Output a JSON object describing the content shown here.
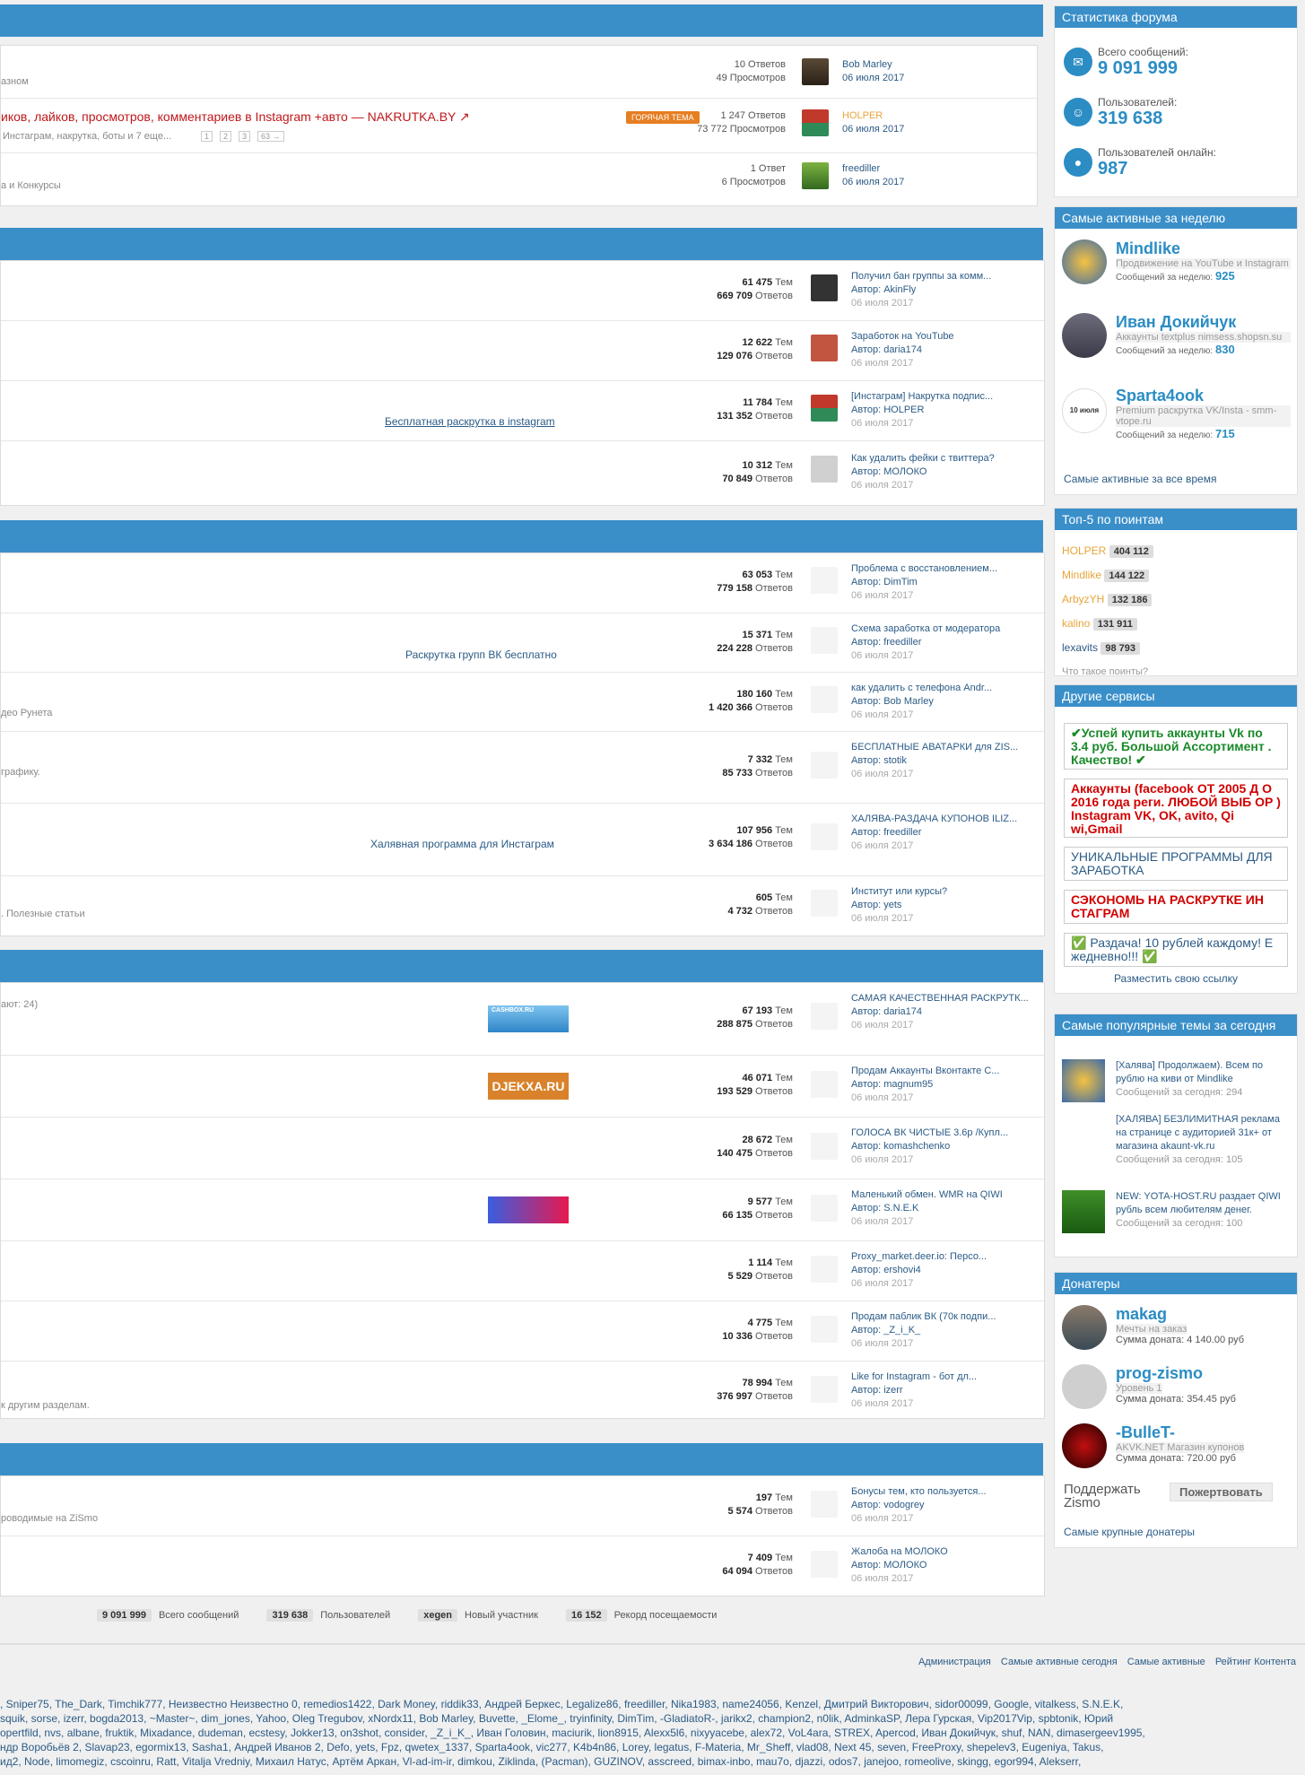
{
  "sec1": {
    "threads": [
      {
        "title": "",
        "sub": "азном",
        "replies": "10 Ответов",
        "views": "49 Просмотров",
        "last_user": "Bob Marley",
        "last_date": "06 июля 2017"
      },
      {
        "title": "иков, лайков, просмотров, комментариев в Instagram +авто — NAKRUTKA.BY ↗",
        "tag": "ГОРЯЧАЯ ТЕМА",
        "sub": "Инстаграм, накрутка, боты и 7 еще...",
        "pages": [
          "1",
          "2",
          "3",
          "63 →"
        ],
        "replies": "1 247 Ответов",
        "views": "73 772 Просмотров",
        "last_user": "HOLPER",
        "last_date": "06 июля 2017"
      },
      {
        "title": "",
        "sub": "а и Конкурсы",
        "replies": "1 Ответ",
        "views": "6 Просмотров",
        "last_user": "freediller",
        "last_date": "06 июля 2017"
      }
    ]
  },
  "sec2": {
    "forums": [
      {
        "link": "",
        "topics": "61 475",
        "posts": "669 709",
        "last_title": "Получил бан группы за комм...",
        "last_author": "Автор: AkinFly",
        "last_date": "06 июля 2017"
      },
      {
        "link": "",
        "topics": "12 622",
        "posts": "129 076",
        "last_title": "Заработок на YouTube",
        "last_author": "Автор: daria174",
        "last_date": "06 июля 2017"
      },
      {
        "link": "Бесплатная раскрутка в instagram",
        "topics": "11 784",
        "posts": "131 352",
        "last_title": "[Инстаграм] Накрутка подпис...",
        "last_author": "Автор: HOLPER",
        "last_date": "06 июля 2017"
      },
      {
        "link": "",
        "topics": "10 312",
        "posts": "70 849",
        "last_title": "Как удалить фейки с твиттера?",
        "last_author": "Автор: МОЛОКО",
        "last_date": "06 июля 2017"
      }
    ]
  },
  "sec3": {
    "forums": [
      {
        "desc": "",
        "link": "",
        "topics": "63 053",
        "posts": "779 158",
        "last_title": "Проблема с восстановлением...",
        "last_author": "Автор: DimTim",
        "last_date": "06 июля 2017"
      },
      {
        "desc": "",
        "link": "Раскрутка групп ВК бесплатно",
        "topics": "15 371",
        "posts": "224 228",
        "last_title": "Схема заработка от модератора",
        "last_author": "Автор: freediller",
        "last_date": "06 июля 2017"
      },
      {
        "desc": "део Рунета",
        "link": "",
        "topics": "180 160",
        "posts": "1 420 366",
        "last_title": "как удалить с телефона Andr...",
        "last_author": "Автор: Bob Marley",
        "last_date": "06 июля 2017"
      },
      {
        "desc": "графику.",
        "link": "",
        "topics": "7 332",
        "posts": "85 733",
        "last_title": "БЕСПЛАТНЫЕ АВАТАРКИ для ZIS...",
        "last_author": "Автор: stotik",
        "last_date": "06 июля 2017"
      },
      {
        "desc": "",
        "link": "Халявная программа для Инстаграм",
        "topics": "107 956",
        "posts": "3 634 186",
        "last_title": "ХАЛЯВА-РАЗДАЧА КУПОНОВ ILIZ...",
        "last_author": "Автор: freediller",
        "last_date": "06 июля 2017"
      },
      {
        "desc": ". Полезные статьи",
        "link": "",
        "topics": "605",
        "posts": "4 732",
        "last_title": "Институт или курсы?",
        "last_author": "Автор: yets",
        "last_date": "06 июля 2017"
      }
    ]
  },
  "sec4": {
    "forums": [
      {
        "desc": "ают: 24)",
        "banner": "CASHBOX.RU",
        "topics": "67 193",
        "posts": "288 875",
        "last_title": "САМАЯ КАЧЕСТВЕННАЯ РАСКРУТК...",
        "last_author": "Автор: daria174",
        "last_date": "06 июля 2017"
      },
      {
        "desc": "",
        "banner": "DJEKXA.RU",
        "topics": "46 071",
        "posts": "193 529",
        "last_title": "Продам Аккаунты Вконтакте С...",
        "last_author": "Автор: magnum95",
        "last_date": "06 июля 2017"
      },
      {
        "desc": "",
        "banner": "",
        "topics": "28 672",
        "posts": "140 475",
        "last_title": "ГОЛОСА ВК ЧИСТЫЕ 3.6р /Купл...",
        "last_author": "Автор: komashchenko",
        "last_date": "06 июля 2017"
      },
      {
        "desc": "",
        "banner": "gradient",
        "topics": "9 577",
        "posts": "66 135",
        "last_title": "Маленький обмен. WMR на QIWI",
        "last_author": "Автор: S.N.E.K",
        "last_date": "06 июля 2017"
      },
      {
        "desc": "",
        "banner": "",
        "topics": "1 114",
        "posts": "5 529",
        "last_title": "Proxy_market.deer.io: Персо...",
        "last_author": "Автор: ershovi4",
        "last_date": "06 июля 2017"
      },
      {
        "desc": "",
        "banner": "",
        "topics": "4 775",
        "posts": "10 336",
        "last_title": "Продам паблик ВК (70к подпи...",
        "last_author": "Автор: _Z_i_K_",
        "last_date": "06 июля 2017"
      },
      {
        "desc": "к другим разделам.",
        "banner": "",
        "topics": "78 994",
        "posts": "376 997",
        "last_title": "Like for Instagram - бот дл...",
        "last_author": "Автор: izerr",
        "last_date": "06 июля 2017"
      }
    ]
  },
  "sec5": {
    "forums": [
      {
        "desc": "роводимые на ZiSmo",
        "topics": "197",
        "posts": "5 574",
        "last_title": "Бонусы тем, кто пользуется...",
        "last_author": "Автор: vodogrey",
        "last_date": "06 июля 2017"
      },
      {
        "desc": "",
        "topics": "7 409",
        "posts": "64 094",
        "last_title": "Жалоба на МОЛОКО",
        "last_author": "Автор: МОЛОКО",
        "last_date": "06 июля 2017"
      }
    ]
  },
  "labels": {
    "topics": "Тем",
    "posts": "Ответов"
  },
  "footer_stats": [
    {
      "value": "9 091 999",
      "label": "Всего сообщений"
    },
    {
      "value": "319 638",
      "label": "Пользователей"
    },
    {
      "value": "xegen",
      "label": "Новый участник"
    },
    {
      "value": "16 152",
      "label": "Рекорд посещаемости"
    }
  ],
  "footer_links": [
    "Администрация",
    "Самые активные сегодня",
    "Самые активные",
    "Рейтинг Контента"
  ],
  "online_users": [
    ", Sniper75, The_Dark, Timchik777, Неизвестно Неизвестно 0, remedios1422, Dark Money, riddik33, Андрей Беркес, Legalize86, freediller, Nika1983, name24056, Kenzel, Дмитрий Викторович, sidor00099, Google, vitalkess, S.N.E.K,",
    "squik, sorse, izerr, bogda2013, ~Master~, dim_jones, Yahoo, Oleg Tregubov, xNordx11, Bob Marley, Buvette, _Elome_, tryinfinity, DimTim, -GladiatoR-, jarikx2, champion2, n0lik, AdminkaSP, Лера Гурская, Vip2017Vip, spbtonik, Юрий",
    "opertfild, nvs, albane, fruktik, Mixadance, dudeman, ecstesy, Jokker13, on3shot, consider, _Z_i_K_, Иван Головин, maciurik, lion8915, Alexx5l6, nixyyacebe, alex72, VoL4ara, STREX, Apercod, Иван Докийчук, shuf, NAN, dimasergeev1995,",
    "ндр Воробьёв 2, Slavap23, egormix13, Sasha1, Андрей Иванов 2, Defo, yets, Fpz, qwetex_1337, Sparta4ook, vic277, K4b4n86, Lorey, legatus, F-Materia, Mr_Sheff, vlad08, Next 45, seven, FreeProxy, shepelev3, Eugeniya, Takus,",
    "ид2, Node, limomegiz, cscoinru, Ratt, Vitalja Vredniy, Михаил Натус, Артём Аркан, Vl-ad-im-ir, dimkou, Ziklinda, (Pacman), GUZINOV, asscreed, bimax-inbo, mau7o, djazzi, odos7, janejoo, romeolive, skingg, egor994, Alekserr,"
  ],
  "sidebar": {
    "stats": {
      "title": "Статистика форума",
      "items": [
        {
          "label": "Всего сообщений:",
          "value": "9 091 999",
          "icon": "comments-icon"
        },
        {
          "label": "Пользователей:",
          "value": "319 638",
          "icon": "users-icon"
        },
        {
          "label": "Пользователей онлайн:",
          "value": "987",
          "icon": "user-online-icon"
        }
      ]
    },
    "weekly": {
      "title": "Самые активные за неделю",
      "users": [
        {
          "name": "Mindlike",
          "status": "Продвижение на YouTube и Instagram",
          "count_label": "Сообщений за неделю:",
          "count": "925"
        },
        {
          "name": "Иван Докийчук",
          "status": "Аккаунты textplus nimsess.shopsn.su",
          "count_label": "Сообщений за неделю:",
          "count": "830"
        },
        {
          "name": "Sparta4ook",
          "status": "Premium раскрутка VK/Insta - smm-vtope.ru",
          "count_label": "Сообщений за неделю:",
          "count": "715",
          "avatar_text": "10 июля"
        }
      ],
      "all_time_link": "Самые активные за все время"
    },
    "top5": {
      "title": "Топ-5 по поинтам",
      "items": [
        {
          "name": "HOLPER",
          "points": "404 112"
        },
        {
          "name": "Mindlike",
          "points": "144 122"
        },
        {
          "name": "ArbyzYH",
          "points": "132 186"
        },
        {
          "name": "kalino",
          "points": "131 911"
        },
        {
          "name": "lexavits",
          "points": "98 793"
        }
      ],
      "help_link": "Что такое поинты?"
    },
    "services": {
      "title": "Другие сервисы",
      "items": [
        "✔Успей купить аккаунты Vk по 3.4 руб. Большой Ассортимент . Качество! ✔",
        "Аккаунты (facebook ОТ 2005 Д О 2016 года реги. ЛЮБОЙ ВЫБ ОР ) Instagram VK, OK, avito, Qi wi,Gmail",
        "УНИКАЛЬНЫЕ ПРОГРАММЫ ДЛЯ ЗАРАБОТКА",
        "СЭКОНОМЬ НА РАСКРУТКЕ ИН СТАГРАМ",
        "✅ Раздача! 10 рублей каждому! Е жедневно!!! ✅"
      ],
      "place_link": "Разместить свою ссылку"
    },
    "popular": {
      "title": "Самые популярные темы за сегодня",
      "items": [
        {
          "title": "[Халява] Продолжаем). Всем по рублю на киви от Mindlike",
          "meta": "Сообщений за сегодня: 294"
        },
        {
          "title": "[ХАЛЯВА] БЕЗЛИМИТНАЯ реклама на странице с аудиторией 31к+ от магазина akaunt-vk.ru",
          "meta": "Сообщений за сегодня: 105"
        },
        {
          "title": "NEW: YOTA-HOST.RU раздает QIWI рубль всем любителям денег.",
          "meta": "Сообщений за сегодня: 100"
        }
      ]
    },
    "donors": {
      "title": "Донатеры",
      "items": [
        {
          "name": "makag",
          "status": "Мечты на заказ",
          "sum": "Сумма доната: 4 140.00 руб"
        },
        {
          "name": "prog-zismo",
          "status": "Уровень 1",
          "sum": "Сумма доната: 354.45 руб"
        },
        {
          "name": "-BulleT-",
          "status": "AKVK.NET Магазин купонов",
          "sum": "Сумма доната: 720.00 руб"
        }
      ],
      "support_label": "Поддержать Zismo",
      "donate_button": "Пожертвовать",
      "top_link": "Самые крупные донатеры"
    }
  }
}
